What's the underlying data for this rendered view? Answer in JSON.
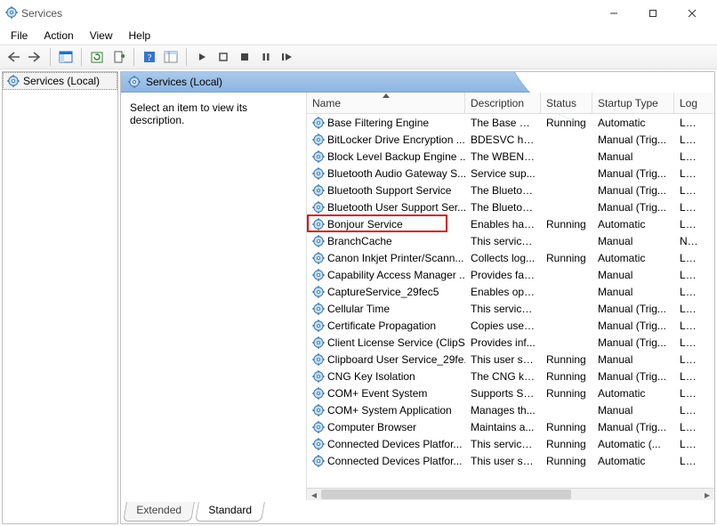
{
  "window": {
    "title": "Services"
  },
  "menu": {
    "file": "File",
    "action": "Action",
    "view": "View",
    "help": "Help"
  },
  "tree": {
    "root": "Services (Local)"
  },
  "pane": {
    "title": "Services (Local)",
    "instruction": "Select an item to view its description."
  },
  "columns": {
    "name": "Name",
    "description": "Description",
    "status": "Status",
    "startup": "Startup Type",
    "logon": "Log"
  },
  "tabs": {
    "extended": "Extended",
    "standard": "Standard"
  },
  "highlighted_index": 6,
  "services": [
    {
      "name": "Base Filtering Engine",
      "desc": "The Base Fil...",
      "status": "Running",
      "startup": "Automatic",
      "logon": "Loc"
    },
    {
      "name": "BitLocker Drive Encryption ...",
      "desc": "BDESVC hos...",
      "status": "",
      "startup": "Manual (Trig...",
      "logon": "Loc"
    },
    {
      "name": "Block Level Backup Engine ...",
      "desc": "The WBENG...",
      "status": "",
      "startup": "Manual",
      "logon": "Loc"
    },
    {
      "name": "Bluetooth Audio Gateway S...",
      "desc": "Service sup...",
      "status": "",
      "startup": "Manual (Trig...",
      "logon": "Loc"
    },
    {
      "name": "Bluetooth Support Service",
      "desc": "The Bluetoo...",
      "status": "",
      "startup": "Manual (Trig...",
      "logon": "Loc"
    },
    {
      "name": "Bluetooth User Support Ser...",
      "desc": "The Bluetoo...",
      "status": "",
      "startup": "Manual (Trig...",
      "logon": "Loc"
    },
    {
      "name": "Bonjour Service",
      "desc": "Enables har...",
      "status": "Running",
      "startup": "Automatic",
      "logon": "Loc"
    },
    {
      "name": "BranchCache",
      "desc": "This service ...",
      "status": "",
      "startup": "Manual",
      "logon": "Net"
    },
    {
      "name": "Canon Inkjet Printer/Scann...",
      "desc": "Collects log...",
      "status": "Running",
      "startup": "Automatic",
      "logon": "Loc"
    },
    {
      "name": "Capability Access Manager ...",
      "desc": "Provides fac...",
      "status": "",
      "startup": "Manual",
      "logon": "Loc"
    },
    {
      "name": "CaptureService_29fec5",
      "desc": "Enables opti...",
      "status": "",
      "startup": "Manual",
      "logon": "Loc"
    },
    {
      "name": "Cellular Time",
      "desc": "This service ...",
      "status": "",
      "startup": "Manual (Trig...",
      "logon": "Loc"
    },
    {
      "name": "Certificate Propagation",
      "desc": "Copies user ...",
      "status": "",
      "startup": "Manual (Trig...",
      "logon": "Loc"
    },
    {
      "name": "Client License Service (ClipS...",
      "desc": "Provides inf...",
      "status": "",
      "startup": "Manual (Trig...",
      "logon": "Loc"
    },
    {
      "name": "Clipboard User Service_29fe...",
      "desc": "This user ser...",
      "status": "Running",
      "startup": "Manual",
      "logon": "Loc"
    },
    {
      "name": "CNG Key Isolation",
      "desc": "The CNG ke...",
      "status": "Running",
      "startup": "Manual (Trig...",
      "logon": "Loc"
    },
    {
      "name": "COM+ Event System",
      "desc": "Supports Sy...",
      "status": "Running",
      "startup": "Automatic",
      "logon": "Loc"
    },
    {
      "name": "COM+ System Application",
      "desc": "Manages th...",
      "status": "",
      "startup": "Manual",
      "logon": "Loc"
    },
    {
      "name": "Computer Browser",
      "desc": "Maintains a...",
      "status": "Running",
      "startup": "Manual (Trig...",
      "logon": "Loc"
    },
    {
      "name": "Connected Devices Platfor...",
      "desc": "This service ...",
      "status": "Running",
      "startup": "Automatic (...",
      "logon": "Loc"
    },
    {
      "name": "Connected Devices Platfor...",
      "desc": "This user ser...",
      "status": "Running",
      "startup": "Automatic",
      "logon": "Loc"
    }
  ]
}
